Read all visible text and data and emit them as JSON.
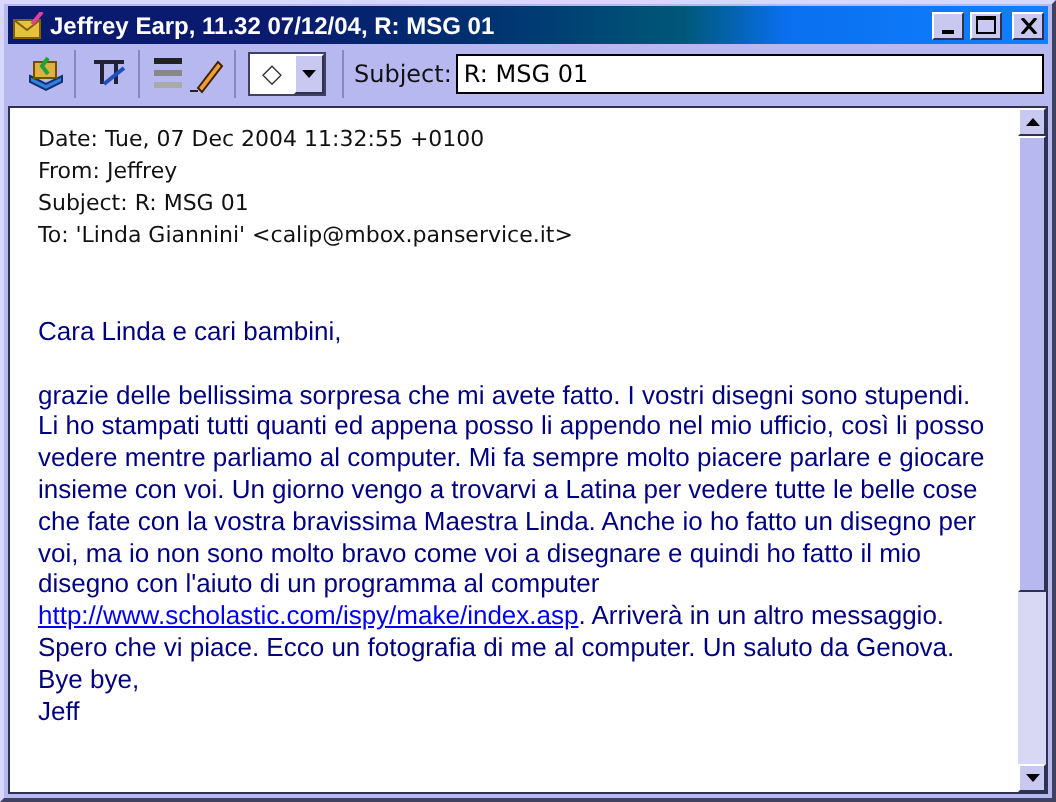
{
  "window": {
    "title": "Jeffrey Earp, 11.32 07/12/04, R: MSG 01"
  },
  "toolbar": {
    "priority_symbol": "◇",
    "subject_label": "Subject:",
    "subject_value": "R: MSG 01"
  },
  "headers": [
    "Date: Tue, 07 Dec 2004 11:32:55 +0100",
    "From: Jeffrey",
    "Subject: R: MSG 01",
    "To: 'Linda Giannini' <calip@mbox.panservice.it>"
  ],
  "body": [
    [
      {
        "text": "Cara Linda e cari bambini,"
      }
    ],
    [
      {
        "text": "grazie delle bellissima sorpresa che mi avete fatto. I vostri disegni sono stupendi."
      },
      {
        "text": "Li ho stampati tutti quanti ed appena posso li appendo nel mio ufficio, così li posso"
      },
      {
        "text": "vedere mentre parliamo al computer. Mi fa sempre molto piacere parlare e giocare"
      },
      {
        "text": "insieme con voi. Un giorno vengo a trovarvi a Latina per vedere tutte le belle cose"
      },
      {
        "text": "che fate con la vostra bravissima Maestra Linda. Anche io ho fatto un disegno per"
      },
      {
        "text": "voi, ma io non sono molto bravo come voi a disegnare e quindi ho fatto il mio"
      },
      {
        "text": "disegno con l'aiuto di un programma al computer"
      },
      {
        "link": "http://www.scholastic.com/ispy/make/index.asp",
        "text": ". Arriverà in un altro messaggio."
      },
      {
        "text": "Spero che vi piace. Ecco un fotografia di me al computer. Un saluto da Genova."
      },
      {
        "text": "Bye bye,"
      },
      {
        "text": "Jeff"
      }
    ]
  ]
}
